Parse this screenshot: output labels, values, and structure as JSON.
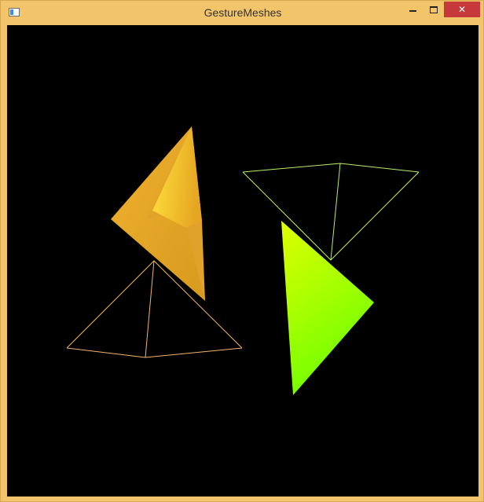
{
  "window": {
    "title": "GestureMeshes",
    "icons": {
      "app": "window-app-icon",
      "minimize": "minimize-icon",
      "maximize": "maximize-icon",
      "close": "close-icon"
    },
    "close_glyph": "✕"
  },
  "scene": {
    "background": "#000000",
    "meshes": [
      {
        "name": "orange-solid-pyramid",
        "style": "solid",
        "color": "#e8a92a"
      },
      {
        "name": "orange-wireframe-pyramid",
        "style": "wireframe",
        "color": "#f2b56a"
      },
      {
        "name": "green-wireframe-pyramid",
        "style": "wireframe",
        "color": "#b9f06a"
      },
      {
        "name": "green-solid-pyramid",
        "style": "solid",
        "color": "#7cff00"
      }
    ]
  }
}
